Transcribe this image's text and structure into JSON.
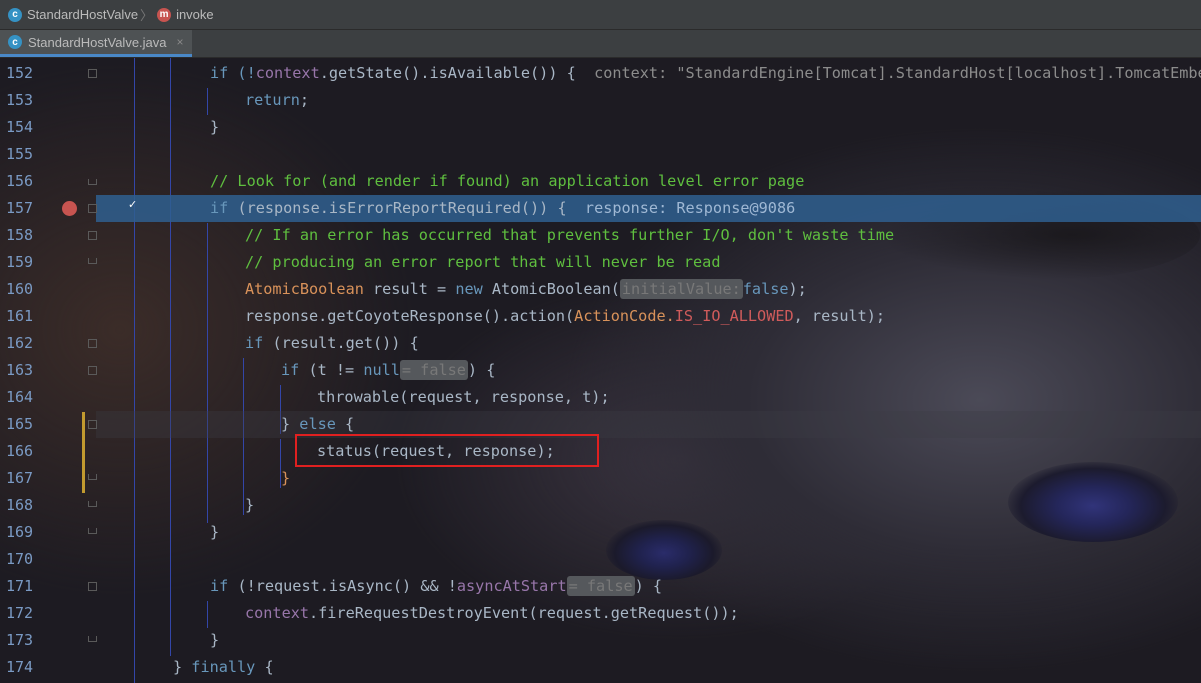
{
  "navbar": {
    "crumb_class": "StandardHostValve",
    "crumb_method": "invoke",
    "class_icon": "class-c-icon",
    "method_icon": "method-m-icon"
  },
  "tab": {
    "label": "StandardHostValve.java",
    "close": "×"
  },
  "editor": {
    "lines": [
      {
        "n": "152"
      },
      {
        "n": "153"
      },
      {
        "n": "154"
      },
      {
        "n": "155"
      },
      {
        "n": "156"
      },
      {
        "n": "157"
      },
      {
        "n": "158"
      },
      {
        "n": "159"
      },
      {
        "n": "160"
      },
      {
        "n": "161"
      },
      {
        "n": "162"
      },
      {
        "n": "163"
      },
      {
        "n": "164"
      },
      {
        "n": "165"
      },
      {
        "n": "166"
      },
      {
        "n": "167"
      },
      {
        "n": "168"
      },
      {
        "n": "169"
      },
      {
        "n": "170"
      },
      {
        "n": "171"
      },
      {
        "n": "172"
      },
      {
        "n": "173"
      },
      {
        "n": "174"
      }
    ],
    "l152": {
      "a": "if (!",
      "b": "context",
      "c": ".getState().isAvailable()) {",
      "inline": "context: \"StandardEngine[Tomcat].StandardHost[localhost].TomcatEmbed"
    },
    "l153": {
      "a": "return",
      "b": ";"
    },
    "l154": {
      "a": "}"
    },
    "l156": {
      "a": "// Look for (and render if found) an application level error page"
    },
    "l157": {
      "a": "if",
      "b": " (response.isErrorReportRequired()) {",
      "inline": "response: Response@9086"
    },
    "l158": {
      "a": "// If an error has occurred that prevents further I/O, don't waste time"
    },
    "l159": {
      "a": "// producing an error report that will never be read"
    },
    "l160": {
      "a": "AtomicBoolean",
      "b": " result = ",
      "c": "new",
      "d": " AtomicBoolean(",
      "hint": "initialValue:",
      "e": "false",
      "f": ");"
    },
    "l161": {
      "a": "response.getCoyoteResponse().action(",
      "b": "ActionCode.",
      "c": "IS_IO_ALLOWED",
      "d": ", result);"
    },
    "l162": {
      "a": "if",
      "b": " (result.get()) {"
    },
    "l163": {
      "a": "if",
      "b": " (t != ",
      "c": "null",
      "hint": "= false",
      "d": ") {"
    },
    "l164": {
      "a": "throwable(request, response, t);"
    },
    "l165": {
      "a": "} ",
      "b": "else",
      "c": " {"
    },
    "l166": {
      "a": "status(request, response);"
    },
    "l167": {
      "a": "}"
    },
    "l168": {
      "a": "}"
    },
    "l169": {
      "a": "}"
    },
    "l171": {
      "a": "if",
      "b": " (!request.isAsync() && !",
      "c": "asyncAtStart",
      "hint": "= false",
      "d": ") {"
    },
    "l172": {
      "a": "context",
      "b": ".fireRequestDestroyEvent(request.getRequest());"
    },
    "l173": {
      "a": "}"
    },
    "l174": {
      "a": "} ",
      "b": "finally",
      "c": " {"
    }
  }
}
